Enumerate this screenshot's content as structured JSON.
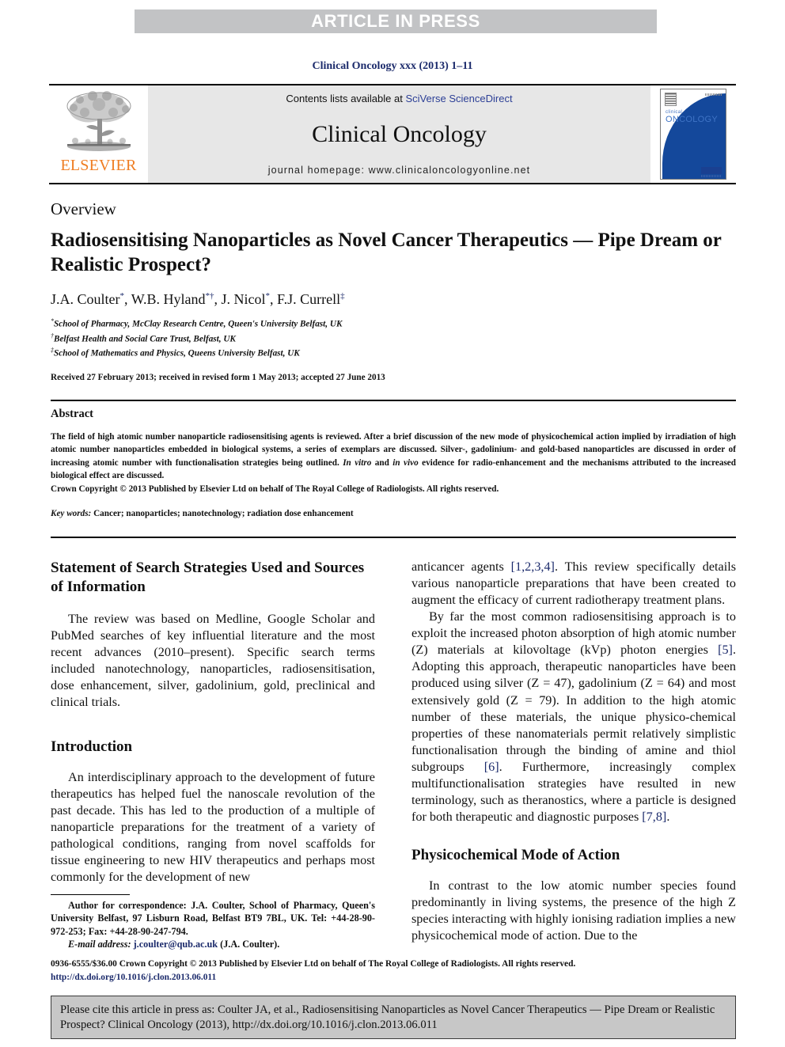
{
  "banner": {
    "text": "ARTICLE IN PRESS",
    "bg_color": "#c2c3c5",
    "text_color": "#ffffff"
  },
  "journal_reference": "Clinical Oncology xxx (2013) 1–11",
  "masthead": {
    "publisher_logo_label": "ELSEVIER",
    "contents_prefix": "Contents lists available at ",
    "contents_link": "SciVerse ScienceDirect",
    "journal_title": "Clinical Oncology",
    "homepage_line": "journal homepage: www.clinicaloncologyonline.net",
    "cover": {
      "line1": "clinical",
      "line2": "ONCOLOGY"
    },
    "link_color": "#2c3f96",
    "panel_bg": "#e7e7e7"
  },
  "article": {
    "type_label": "Overview",
    "title": "Radiosensitising Nanoparticles as Novel Cancer Therapeutics — Pipe Dream or Realistic Prospect?",
    "authors": "J.A. Coulter *, W.B. Hyland *†, J. Nicol *, F.J. Currell ‡",
    "author_parts": [
      {
        "name": "J.A. Coulter",
        "marks": "*"
      },
      {
        "name": "W.B. Hyland",
        "marks": "*†"
      },
      {
        "name": "J. Nicol",
        "marks": "*"
      },
      {
        "name": "F.J. Currell",
        "marks": "‡"
      }
    ],
    "affiliations": [
      {
        "mark": "*",
        "text": "School of Pharmacy, McClay Research Centre, Queen's University Belfast, UK"
      },
      {
        "mark": "†",
        "text": "Belfast Health and Social Care Trust, Belfast, UK"
      },
      {
        "mark": "‡",
        "text": "School of Mathematics and Physics, Queens University Belfast, UK"
      }
    ],
    "received": "Received 27 February 2013; received in revised form 1 May 2013; accepted 27 June 2013"
  },
  "abstract": {
    "heading": "Abstract",
    "text_part_1": "The field of high atomic number nanoparticle radiosensitising agents is reviewed. After a brief discussion of the new mode of physicochemical action implied by irradiation of high atomic number nanoparticles embedded in biological systems, a series of exemplars are discussed. Silver-, gadolinium- and gold-based nanoparticles are discussed in order of increasing atomic number with functionalisation strategies being outlined. ",
    "text_italic_1": "In vitro",
    "text_part_2": " and ",
    "text_italic_2": "in vivo",
    "text_part_3": " evidence for radio-enhancement and the mechanisms attributed to the increased biological effect are discussed.",
    "copyright": "Crown Copyright © 2013 Published by Elsevier Ltd on behalf of The Royal College of Radiologists. All rights reserved.",
    "keywords_label": "Key words:",
    "keywords_value": " Cancer; nanoparticles; nanotechnology; radiation dose enhancement"
  },
  "body": {
    "left_column": {
      "heading_1": "Statement of Search Strategies Used and Sources of Information",
      "paragraph_1": "The review was based on Medline, Google Scholar and PubMed searches of key influential literature and the most recent advances (2010–present). Specific search terms included nanotechnology, nanoparticles, radiosensitisation, dose enhancement, silver, gadolinium, gold, preclinical and clinical trials.",
      "heading_2": "Introduction",
      "paragraph_2": "An interdisciplinary approach to the development of future therapeutics has helped fuel the nanoscale revolution of the past decade. This has led to the production of a multiple of nanoparticle preparations for the treatment of a variety of pathological conditions, ranging from novel scaffolds for tissue engineering to new HIV therapeutics and perhaps most commonly for the development of new"
    },
    "right_column": {
      "paragraph_1_pre": "anticancer agents ",
      "paragraph_1_ref": "[1,2,3,4]",
      "paragraph_1_post": ". This review specifically details various nanoparticle preparations that have been created to augment the efficacy of current radiotherapy treatment plans.",
      "paragraph_2_pre": "By far the most common radiosensitising approach is to exploit the increased photon absorption of high atomic number (Z) materials at kilovoltage (kVp) photon energies ",
      "paragraph_2_ref1": "[5]",
      "paragraph_2_mid1": ". Adopting this approach, therapeutic nanoparticles have been produced using silver (Z = 47), gadolinium (Z = 64) and most extensively gold (Z = 79). In addition to the high atomic number of these materials, the unique physico-chemical properties of these nanomaterials permit relatively simplistic functionalisation through the binding of amine and thiol subgroups ",
      "paragraph_2_ref2": "[6]",
      "paragraph_2_mid2": ". Furthermore, increasingly complex multifunctionalisation strategies have resulted in new terminology, such as theranostics, where a particle is designed for both therapeutic and diagnostic purposes ",
      "paragraph_2_ref3": "[7,8]",
      "paragraph_2_post": ".",
      "heading_1": "Physicochemical Mode of Action",
      "paragraph_3": "In contrast to the low atomic number species found predominantly in living systems, the presence of the high Z species interacting with highly ionising radiation implies a new physicochemical mode of action. Due to the"
    }
  },
  "footnote": {
    "correspondence": "Author for correspondence: J.A. Coulter, School of Pharmacy, Queen's University Belfast, 97 Lisburn Road, Belfast BT9 7BL, UK. Tel: +44-28-90-972-253; Fax: +44-28-90-247-794.",
    "email_label": "E-mail address:",
    "email_link": "j.coulter@qub.ac.uk",
    "email_suffix": " (J.A. Coulter)."
  },
  "copyright_footer": {
    "line": "0936-6555/$36.00 Crown Copyright © 2013 Published by Elsevier Ltd on behalf of The Royal College of Radiologists. All rights reserved.",
    "doi": "http://dx.doi.org/10.1016/j.clon.2013.06.011"
  },
  "cite_box": {
    "text": "Please cite this article in press as: Coulter JA, et al., Radiosensitising Nanoparticles as Novel Cancer Therapeutics — Pipe Dream or Realistic Prospect? Clinical Oncology (2013), http://dx.doi.org/10.1016/j.clon.2013.06.011",
    "bg_color": "#c7c7c7",
    "border_color": "#3a3a3a"
  }
}
